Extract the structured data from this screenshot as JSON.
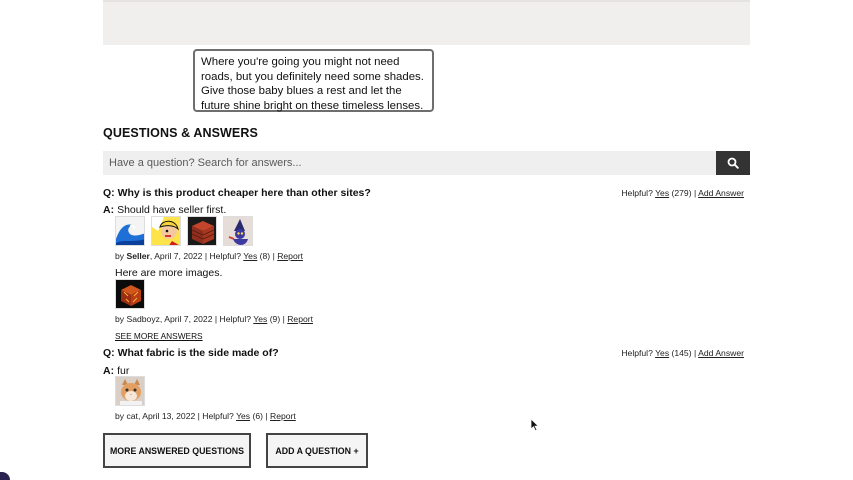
{
  "tooltip": {
    "text": "Where you're going you might not need roads, but you definitely need some shades. Give those baby blues a rest and let the future shine bright on these timeless lenses."
  },
  "qa": {
    "title": "QUESTIONS & ANSWERS",
    "search_placeholder": "Have a question? Search for answers..."
  },
  "questions": [
    {
      "prefix": "Q:",
      "text": "Why is this product cheaper here than other sites?",
      "helpful_label": "Helpful?",
      "yes_label": "Yes",
      "yes_count": "(279)",
      "sep": "|",
      "add_answer": "Add Answer",
      "answers": [
        {
          "prefix": "A:",
          "text": "Should have seller first.",
          "by": "by",
          "author": "Seller",
          "date": ", April 7, 2022",
          "helpful_label": "| Helpful?",
          "yes_label": "Yes",
          "yes_count": "(8)",
          "sep": "|",
          "report": "Report",
          "images": [
            "wave",
            "pop-art",
            "brick-block",
            "wizard"
          ]
        },
        {
          "text": "Here are more images.",
          "by": "by",
          "author": "Sadboyz",
          "date": ", April 7, 2022",
          "helpful_label": "| Helpful?",
          "yes_label": "Yes",
          "yes_count": "(9)",
          "sep": "|",
          "report": "Report",
          "images": [
            "fire-cube"
          ]
        }
      ],
      "see_more": "SEE MORE ANSWERS"
    },
    {
      "prefix": "Q:",
      "text": "What fabric is the side made of?",
      "helpful_label": "Helpful?",
      "yes_label": "Yes",
      "yes_count": "(145)",
      "sep": "|",
      "add_answer": "Add Answer",
      "answers": [
        {
          "prefix": "A:",
          "text": "fur",
          "by": "by",
          "author": "cat",
          "date": ", April 13, 2022",
          "helpful_label": "| Helpful?",
          "yes_label": "Yes",
          "yes_count": "(6)",
          "sep": "|",
          "report": "Report",
          "images": [
            "cat"
          ]
        }
      ]
    }
  ],
  "buttons": {
    "more_answered": "MORE ANSWERED QUESTIONS",
    "add_question": "ADD A QUESTION +"
  },
  "colors": {
    "search_button": "#333333",
    "banner": "#f1eeee"
  },
  "icons": {
    "search": "magnifier-icon"
  }
}
